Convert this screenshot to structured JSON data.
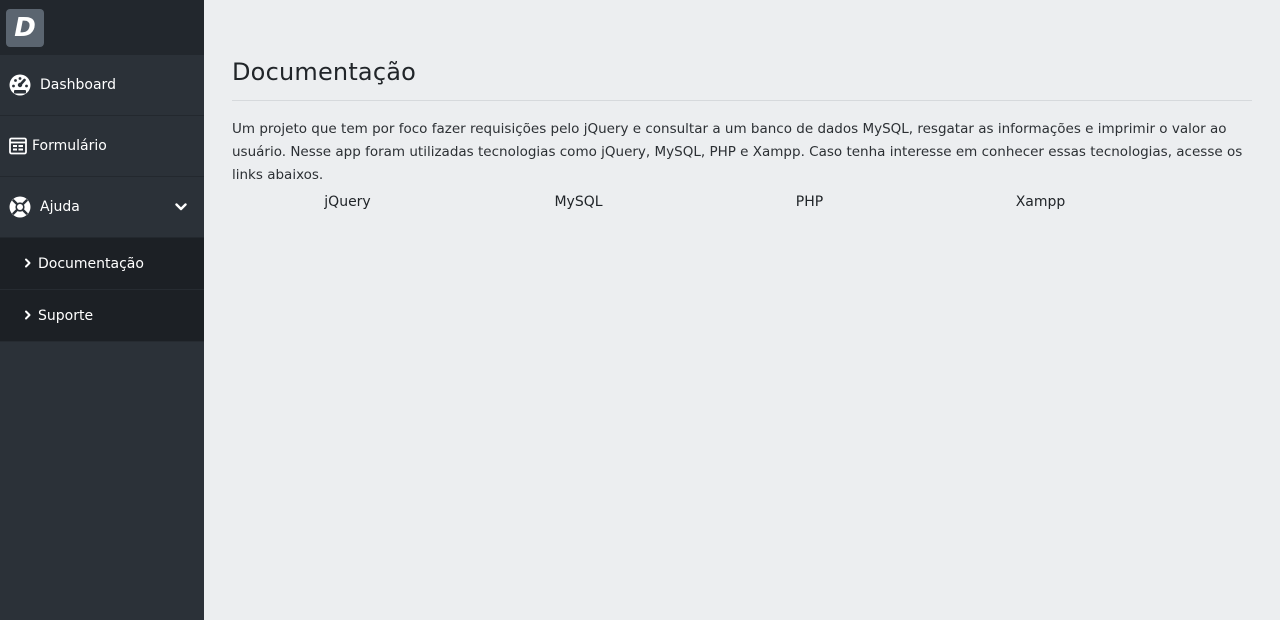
{
  "brand": {
    "logo_letter": "D"
  },
  "sidebar": {
    "items": [
      {
        "label": "Dashboard",
        "icon": "dashboard-gauge-icon"
      },
      {
        "label": "Formulário",
        "icon": "form-icon"
      },
      {
        "label": "Ajuda",
        "icon": "lifebuoy-icon",
        "expanded": true
      }
    ],
    "submenu": [
      {
        "label": "Documentação",
        "icon": "chevron-right-icon"
      },
      {
        "label": "Suporte",
        "icon": "chevron-right-icon"
      }
    ]
  },
  "main": {
    "title": "Documentação",
    "description": "Um projeto que tem por foco fazer requisições pelo jQuery e consultar a um banco de dados MySQL, resgatar as informações e imprimir o valor ao usuário. Nesse app foram utilizadas tecnologias como jQuery, MySQL, PHP e Xampp. Caso tenha interesse em conhecer essas tecnologias, acesse os links abaixos.",
    "links": [
      "jQuery",
      "MySQL",
      "PHP",
      "Xampp"
    ]
  },
  "colors": {
    "sidebar_bg": "#2b3138",
    "brand_bg": "#22272d",
    "submenu_bg": "#1c2025",
    "main_bg": "#eceef0"
  }
}
